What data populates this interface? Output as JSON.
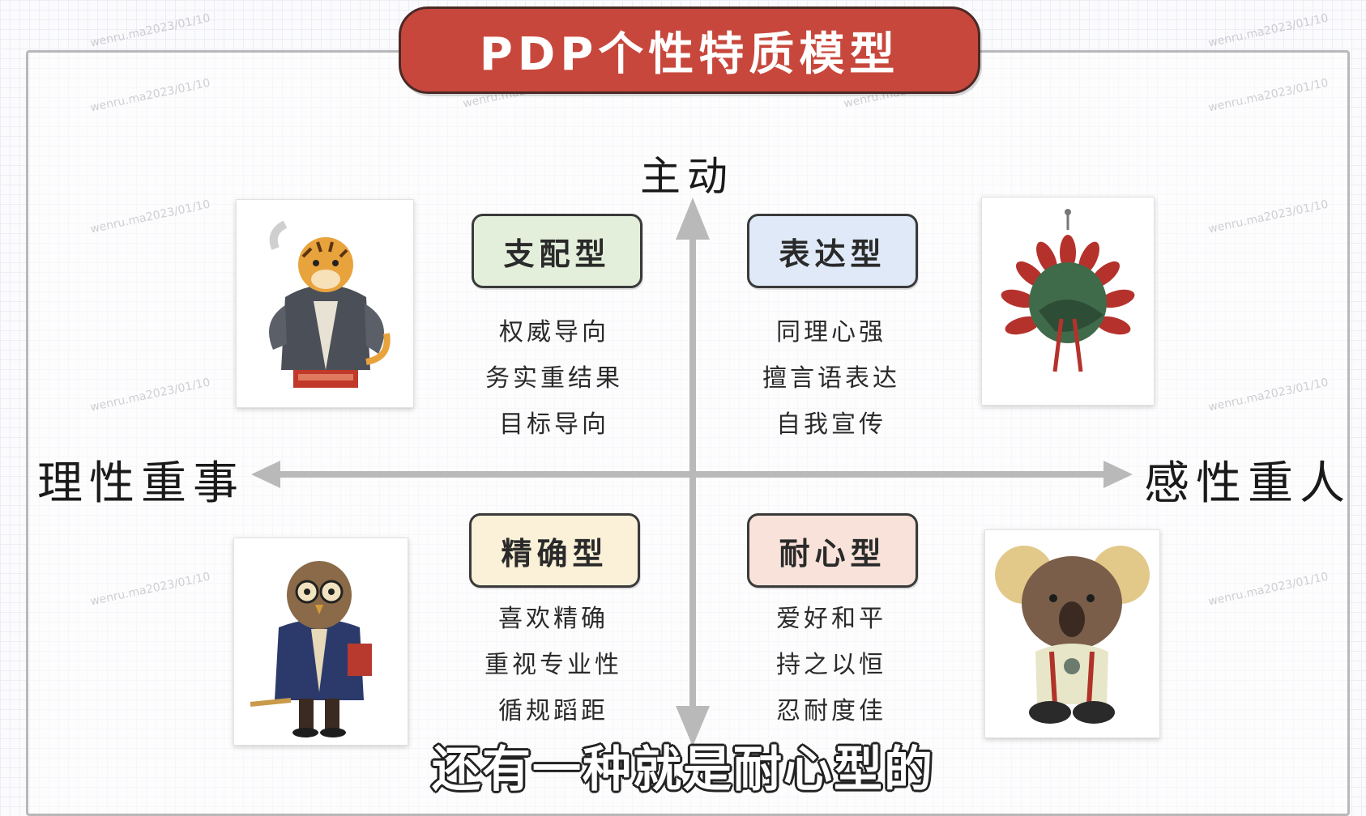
{
  "title": "PDP个性特质模型",
  "axes": {
    "top": "主动",
    "left": "理性重事",
    "right": "感性重人"
  },
  "quadrants": {
    "dominant": {
      "label": "支配型",
      "traits": [
        "权威导向",
        "务实重结果",
        "目标导向"
      ],
      "color": "#e3efdb",
      "image": "tiger-in-suit"
    },
    "expressive": {
      "label": "表达型",
      "traits": [
        "同理心强",
        "擅言语表达",
        "自我宣传"
      ],
      "color": "#dfe9f8",
      "image": "peacock"
    },
    "precise": {
      "label": "精确型",
      "traits": [
        "喜欢精确",
        "重视专业性",
        "循规蹈距"
      ],
      "color": "#fbf1d8",
      "image": "owl-in-suit"
    },
    "patient": {
      "label": "耐心型",
      "traits": [
        "爱好和平",
        "持之以恒",
        "忍耐度佳"
      ],
      "color": "#f8e2da",
      "image": "koala"
    }
  },
  "watermark": "wenru.ma2023/01/10",
  "subtitle": "还有一种就是耐心型的",
  "colors": {
    "banner": "#c8473c",
    "axis": "#b9b9b9"
  }
}
